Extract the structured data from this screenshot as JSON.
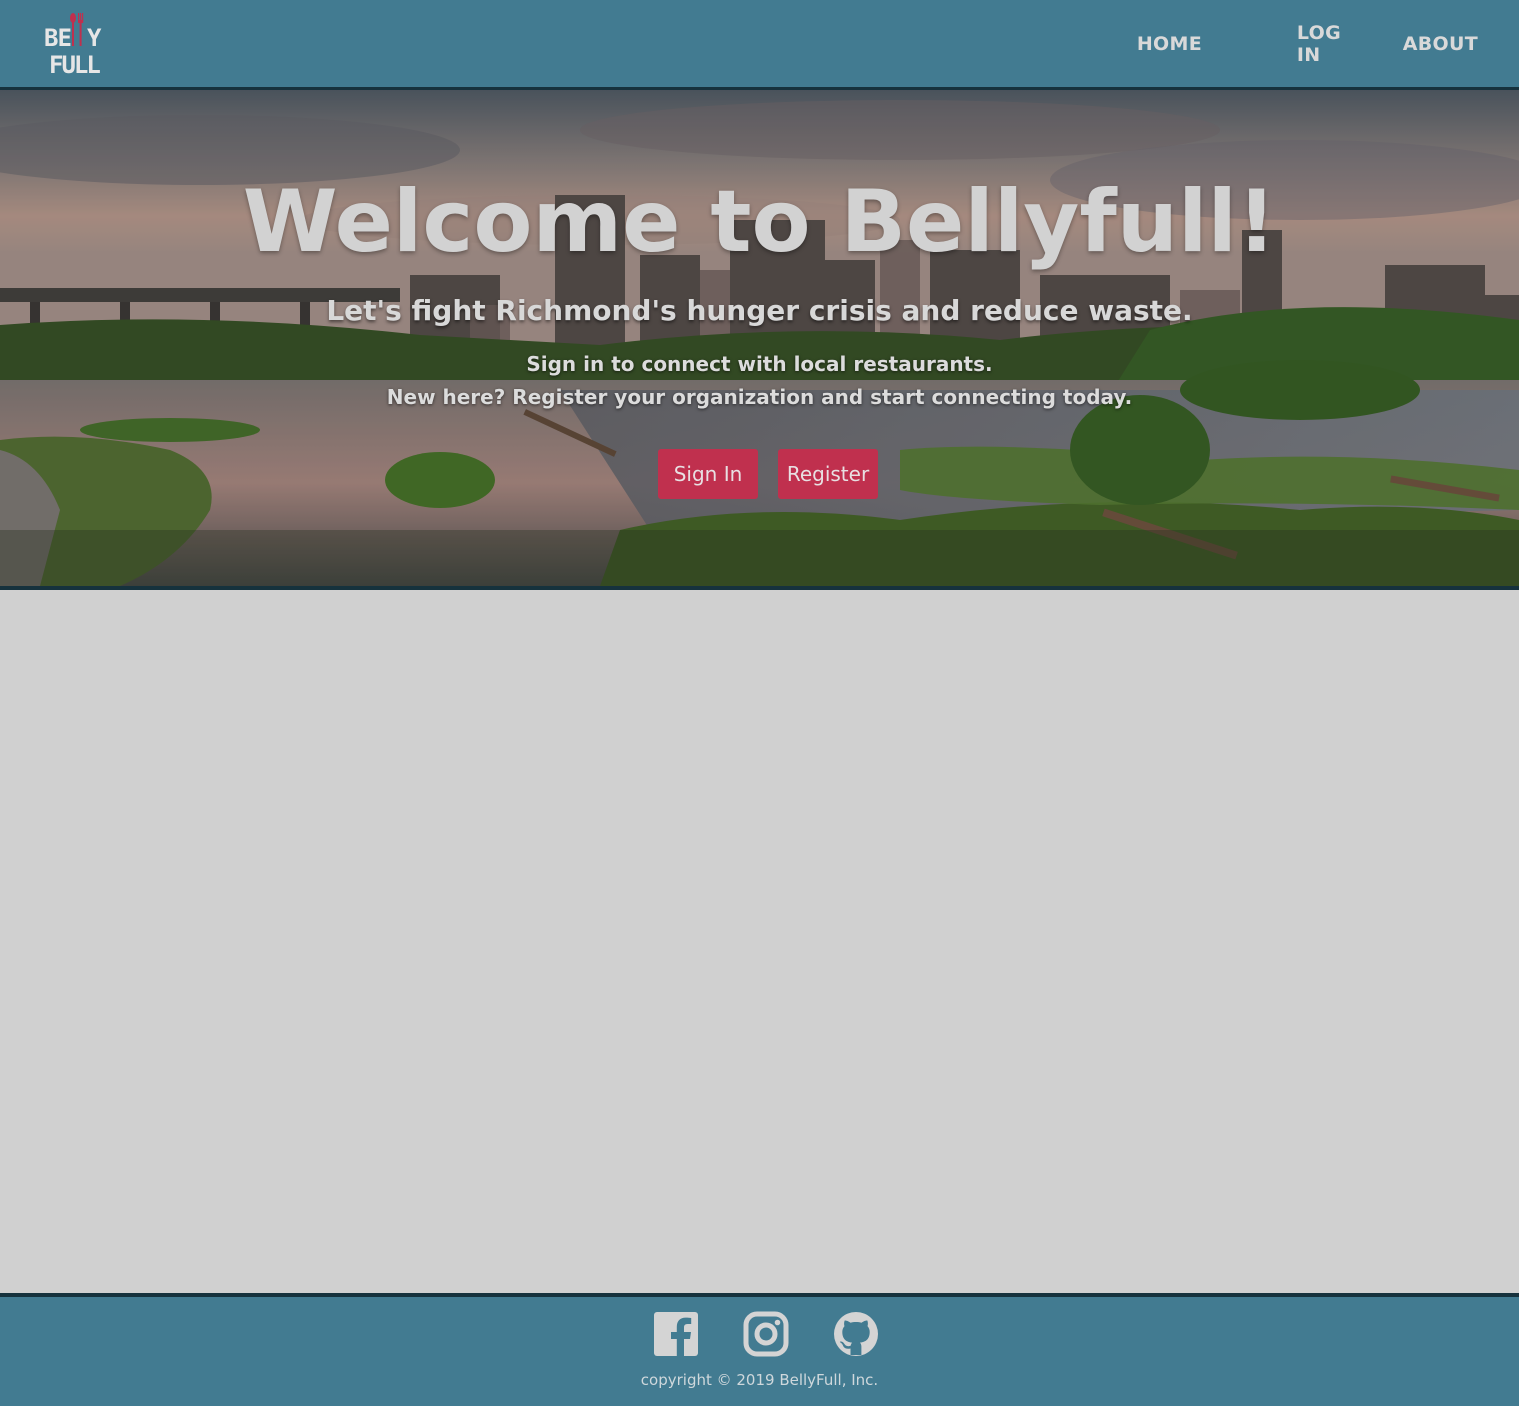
{
  "header": {
    "logo_alt": "BELLY FULL",
    "logo_line1": "BE  Y",
    "logo_line2": "FULL",
    "nav": {
      "home": "HOME",
      "login": "LOG IN",
      "about": "ABOUT"
    }
  },
  "hero": {
    "title": "Welcome to Bellyfull!",
    "subtitle": "Let's fight Richmond's hunger crisis and reduce waste.",
    "line1": "Sign in to connect with local restaurants.",
    "line2": "New here? Register your organization and start connecting today.",
    "signin_label": "Sign In",
    "register_label": "Register"
  },
  "footer": {
    "icons": [
      "facebook-icon",
      "instagram-icon",
      "github-icon"
    ],
    "copyright": "copyright © 2019 BellyFull, Inc."
  },
  "colors": {
    "navbar": "#427b91",
    "border": "#16323d",
    "button": "#c0304e",
    "background": "#d0d0d0"
  }
}
